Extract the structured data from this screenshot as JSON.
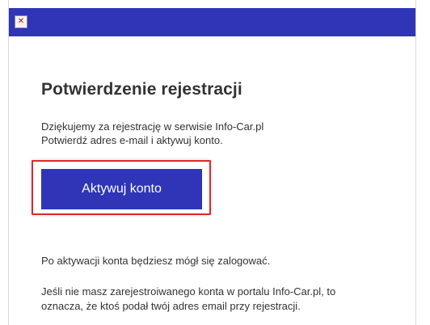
{
  "header": {
    "broken_image_icon": "broken-image-icon",
    "bar_color": "#2f35b6"
  },
  "email": {
    "title": "Potwierdzenie rejestracji",
    "intro_line1": "Dziękujemy za rejestrację w serwisie Info-Car.pl",
    "intro_line2": "Potwierdź adres e-mail i aktywuj konto.",
    "activate_button_label": "Aktywuj konto",
    "after_activation_note": "Po aktywacji konta będziesz mógł się zalogować.",
    "warning_line1": "Jeśli nie masz zarejestroiwanego konta w portalu Info-Car.pl, to",
    "warning_line2": "oznacza, że ktoś podał twój adres email przy rejestracji."
  },
  "colors": {
    "accent": "#2f35b6",
    "highlight": "#e0272b",
    "text": "#333333"
  }
}
